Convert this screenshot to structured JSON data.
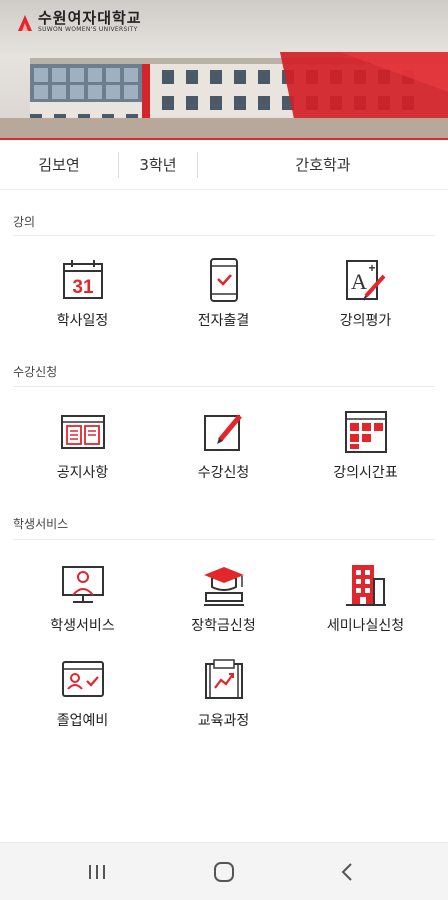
{
  "app": {
    "logo_ko": "수원여자대학교",
    "logo_en": "SUWON WOMEN'S UNIVERSITY",
    "brand_color": "#e3262c"
  },
  "profile": {
    "name": "김보연",
    "grade": "3학년",
    "department": "간호학과"
  },
  "sections": [
    {
      "title": "강의",
      "items": [
        {
          "label": "학사일정",
          "icon": "calendar-icon",
          "calendar_day": "31"
        },
        {
          "label": "전자출결",
          "icon": "phone-check-icon"
        },
        {
          "label": "강의평가",
          "icon": "grade-a-plus-icon"
        }
      ]
    },
    {
      "title": "수강신청",
      "items": [
        {
          "label": "공지사항",
          "icon": "notice-board-icon"
        },
        {
          "label": "수강신청",
          "icon": "edit-pencil-icon"
        },
        {
          "label": "강의시간표",
          "icon": "timetable-icon"
        }
      ]
    },
    {
      "title": "학생서비스",
      "items": [
        {
          "label": "학생서비스",
          "icon": "student-computer-icon"
        },
        {
          "label": "장학금신청",
          "icon": "graduation-cap-icon"
        },
        {
          "label": "세미나실신청",
          "icon": "building-icon"
        },
        {
          "label": "졸업예비",
          "icon": "id-card-icon"
        },
        {
          "label": "교육과정",
          "icon": "curriculum-book-icon"
        }
      ]
    }
  ],
  "system_nav": {
    "recent_icon": "recent-apps-icon",
    "home_icon": "home-icon",
    "back_icon": "back-icon"
  }
}
